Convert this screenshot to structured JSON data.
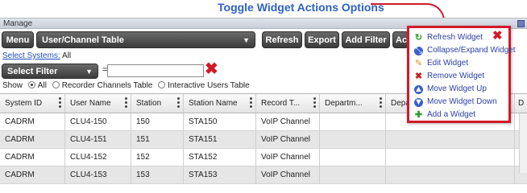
{
  "caption": "Toggle Widget Actions Options",
  "widget": {
    "title": "Manage"
  },
  "toolbar": {
    "menu_label": "Menu",
    "table_select": "User/Channel Table",
    "refresh_label": "Refresh",
    "export_label": "Export",
    "add_filter_label": "Add Filter",
    "partial_button_label": "Ac"
  },
  "systems": {
    "link_label": "Select Systems:",
    "value": "All"
  },
  "filter": {
    "select_label": "Select Filter",
    "equals": "=",
    "value": ""
  },
  "show": {
    "label": "Show",
    "options": [
      "All",
      "Recorder Channels Table",
      "Interactive Users Table"
    ],
    "selected": "All"
  },
  "table": {
    "columns": [
      "System ID",
      "User Name",
      "Station",
      "Station Name",
      "Record T...",
      "Departm...",
      "Depa",
      "D"
    ],
    "rows": [
      [
        "CADRM",
        "CLU4-150",
        "150",
        "STA150",
        "VoIP Channel",
        "",
        "",
        ""
      ],
      [
        "CADRM",
        "CLU4-151",
        "151",
        "STA151",
        "VoIP Channel",
        "",
        "",
        ""
      ],
      [
        "CADRM",
        "CLU4-152",
        "152",
        "STA152",
        "VoIP Channel",
        "",
        "",
        ""
      ],
      [
        "CADRM",
        "CLU4-153",
        "153",
        "STA153",
        "VoIP Channel",
        "",
        "",
        ""
      ]
    ]
  },
  "widget_menu": {
    "items": [
      {
        "label": "Refresh Widget",
        "icon": "refresh-icon"
      },
      {
        "label": "Collapse/Expand Widget",
        "icon": "collapse-expand-icon"
      },
      {
        "label": "Edit Widget",
        "icon": "edit-icon"
      },
      {
        "label": "Remove Widget",
        "icon": "remove-icon"
      },
      {
        "label": "Move Widget Up",
        "icon": "arrow-up-icon"
      },
      {
        "label": "Move Widget Down",
        "icon": "arrow-down-icon"
      },
      {
        "label": "Add a Widget",
        "icon": "plus-icon"
      }
    ]
  },
  "colors": {
    "caption_blue": "#2e62c4",
    "highlight_red": "#d11a2a",
    "menu_text": "#2b3fa8",
    "button_dark": "#3b3b3b"
  }
}
